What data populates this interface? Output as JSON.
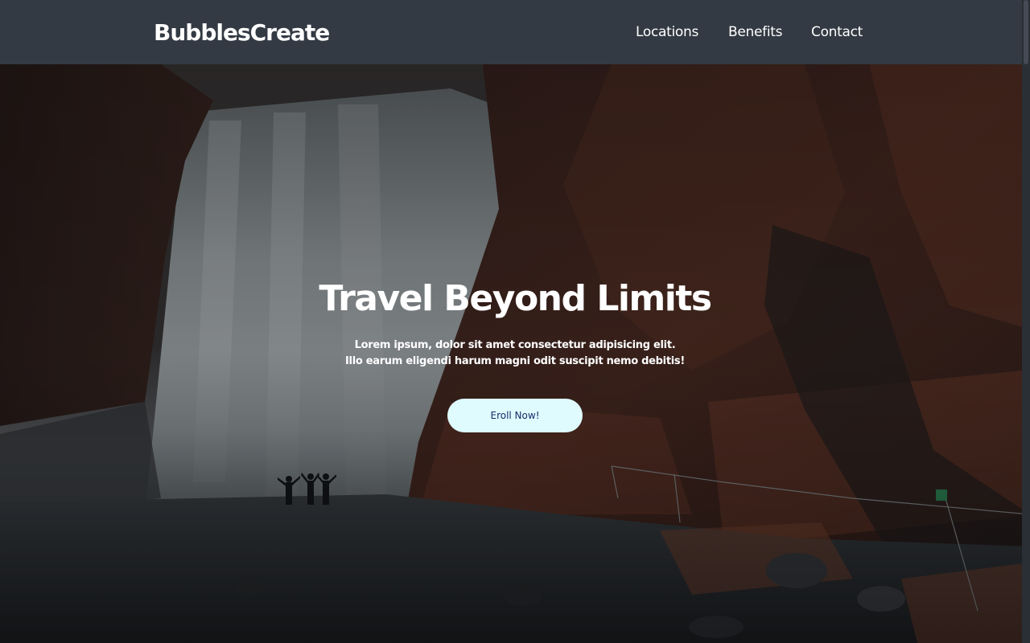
{
  "navbar": {
    "brand": "BubblesCreate",
    "links": [
      "Locations",
      "Benefits",
      "Contact"
    ]
  },
  "hero": {
    "title": "Travel Beyond Limits",
    "subtitle_lines": [
      "Lorem ipsum, dolor sit amet consectetur adipisicing elit.",
      "Illo earum eligendi harum magni odit suscipit nemo debitis!"
    ],
    "cta_label": "Eroll Now!"
  },
  "colors": {
    "navbar_bg": "#333a43",
    "cta_bg": "#dffbfd",
    "cta_text": "#1a2a6a",
    "text": "#ffffff"
  },
  "icons": {
    "hero_image": "waterfall-landscape-photo"
  }
}
